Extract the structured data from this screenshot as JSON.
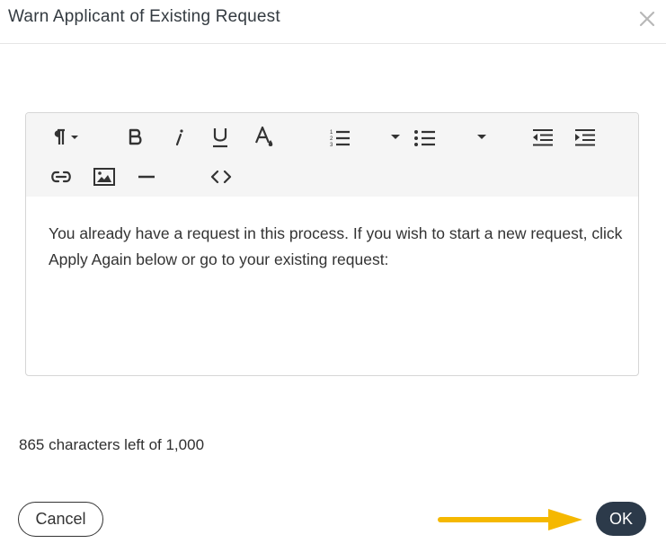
{
  "dialog": {
    "title": "Warn Applicant of Existing Request",
    "close_icon": "close-icon"
  },
  "toolbar": {
    "items": [
      {
        "name": "paragraph-format",
        "icon": "pilcrow-icon"
      },
      {
        "name": "bold",
        "icon": "bold-icon"
      },
      {
        "name": "italic",
        "icon": "italic-icon"
      },
      {
        "name": "underline",
        "icon": "underline-icon"
      },
      {
        "name": "text-color",
        "icon": "text-color-icon"
      },
      {
        "name": "ordered-list",
        "icon": "ordered-list-icon"
      },
      {
        "name": "unordered-list",
        "icon": "unordered-list-icon"
      },
      {
        "name": "outdent",
        "icon": "outdent-icon"
      },
      {
        "name": "indent",
        "icon": "indent-icon"
      },
      {
        "name": "link",
        "icon": "link-icon"
      },
      {
        "name": "image",
        "icon": "image-icon"
      },
      {
        "name": "horizontal-rule",
        "icon": "horizontal-rule-icon"
      },
      {
        "name": "code-view",
        "icon": "code-icon"
      }
    ]
  },
  "editor": {
    "text": "You already have a request in this process. If you wish to start a new request, click Apply Again below or go to your existing request:"
  },
  "footer": {
    "char_count": "865 characters left of 1,000",
    "cancel_label": "Cancel",
    "ok_label": "OK"
  },
  "colors": {
    "ok_button": "#2c3a4a",
    "arrow": "#f5b800",
    "toolbar_bg": "#f5f5f5"
  }
}
